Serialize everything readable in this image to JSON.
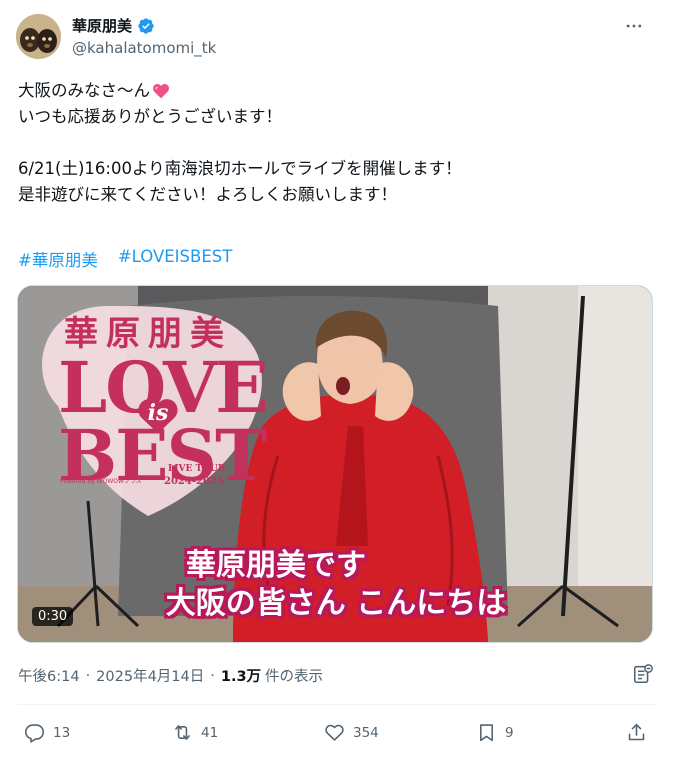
{
  "author": {
    "display_name": "華原朋美",
    "handle": "@kahalatomomi_tk",
    "verified": true,
    "avatar_icon": "profile-photo-avatar"
  },
  "post": {
    "lines": [
      "大阪のみなさ〜ん",
      "いつも応援ありがとうございます！",
      "6/21(土)16:00より南海浪切ホールでライブを開催します！",
      "是非遊びに来てください！よろしくお願いします！"
    ],
    "emoji_icon": "sparkling-heart-icon",
    "hashtags": [
      "#華原朋美",
      "#LOVEISBEST"
    ]
  },
  "media": {
    "logo_name": "華原朋美",
    "logo_love": "LOVE",
    "logo_is": "is",
    "logo_best": "BEST",
    "logo_tour": "LIVE TOUR",
    "logo_years": "2024-2025",
    "logo_powered": "Powered by WOWOWプラス",
    "caption_line1": "華原朋美です",
    "caption_line2": "大阪の皆さん こんにちは",
    "duration": "0:30"
  },
  "meta": {
    "time": "午後6:14",
    "date": "2025年4月14日",
    "views": "1.3万",
    "views_label": "件の表示",
    "separator": "·"
  },
  "actions": {
    "replies": "13",
    "reposts": "41",
    "likes": "354",
    "bookmarks": "9"
  },
  "colors": {
    "accent": "#1d9bf0",
    "text": "#0f1419",
    "muted": "#536471",
    "logo_pink": "#c4305c"
  }
}
